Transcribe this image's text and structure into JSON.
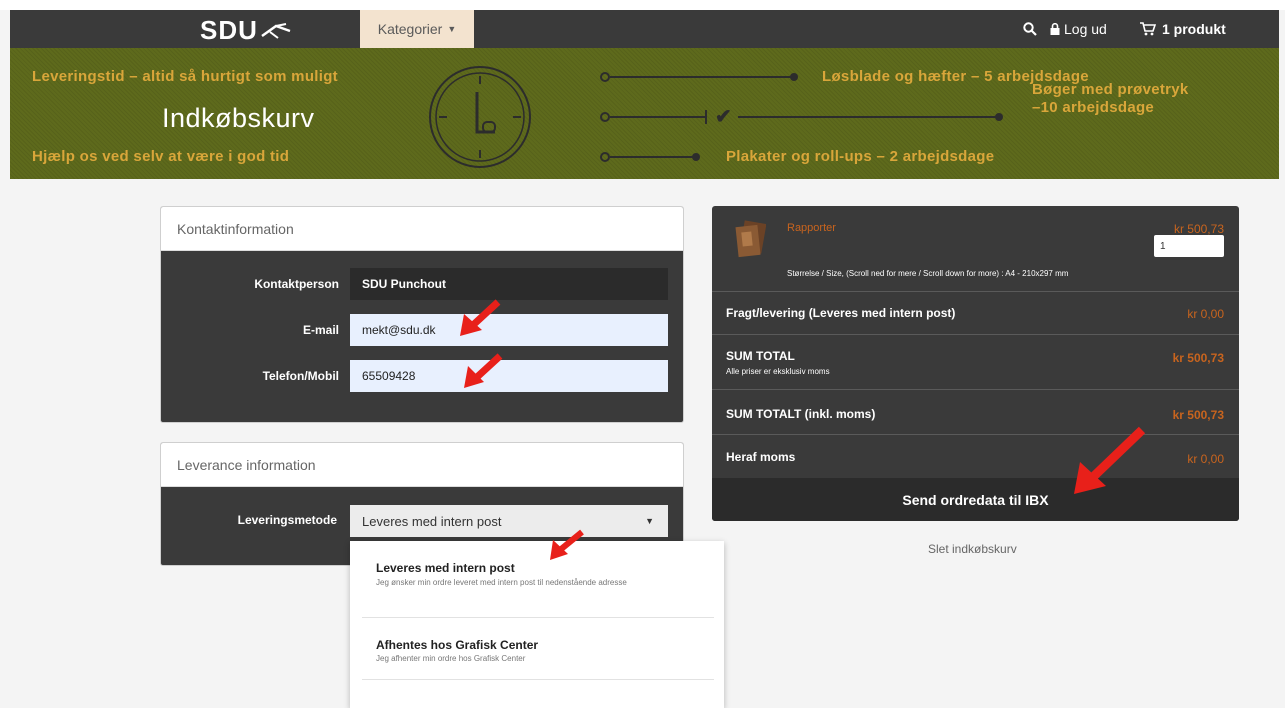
{
  "nav": {
    "logo": "SDU",
    "categories_label": "Kategorier",
    "logout_label": "Log ud",
    "cart_label": "1 produkt"
  },
  "banner": {
    "top_text": "Leveringstid – altid så hurtigt som muligt",
    "title": "Indkøbskurv",
    "bottom_text": "Hjælp os ved selv at være i god tid",
    "timeline": [
      {
        "text": "Løsblade og hæfter – 5 arbejdsdage"
      },
      {
        "text_line1": "Bøger med prøvetryk",
        "text_line2": "–10 arbejdsdage"
      },
      {
        "text": "Plakater og roll-ups – 2 arbejdsdage"
      }
    ]
  },
  "contact": {
    "heading": "Kontaktinformation",
    "fields": [
      {
        "label": "Kontaktperson",
        "value": "SDU Punchout"
      },
      {
        "label": "E-mail",
        "value": "mekt@sdu.dk"
      },
      {
        "label": "Telefon/Mobil",
        "value": "65509428"
      }
    ]
  },
  "delivery": {
    "heading": "Leverance information",
    "method_label": "Leveringsmetode",
    "selected": "Leveres med intern post",
    "options": [
      {
        "title": "Leveres med intern post",
        "description": "Jeg ønsker min ordre leveret med intern post til nedenstående adresse"
      },
      {
        "title": "Afhentes hos Grafisk Center",
        "description": "Jeg afhenter min ordre hos Grafisk Center"
      }
    ]
  },
  "cart": {
    "product_name": "Rapporter",
    "product_price": "kr 500,73",
    "quantity": "1",
    "size_text": "Størrelse / Size, (Scroll ned for mere / Scroll down for more) : A4 - 210x297 mm",
    "shipping_label": "Fragt/levering (Leveres med intern post)",
    "shipping_price": "kr 0,00",
    "sum_label": "SUM TOTAL",
    "sum_note": "Alle priser er eksklusiv moms",
    "sum_price": "kr 500,73",
    "sum_incl_label": "SUM TOTALT (inkl. moms)",
    "sum_incl_price": "kr 500,73",
    "vat_label": "Heraf moms",
    "vat_price": "kr 0,00",
    "send_button": "Send ordredata til IBX"
  },
  "clear_cart": "Slet indkøbskurv",
  "colors": {
    "nav_bg": "#3a3a3a",
    "banner_bg": "#5e6a1c",
    "banner_accent": "#d9a63a",
    "price_orange": "#c8641e",
    "arrow_red": "#e8201a"
  }
}
